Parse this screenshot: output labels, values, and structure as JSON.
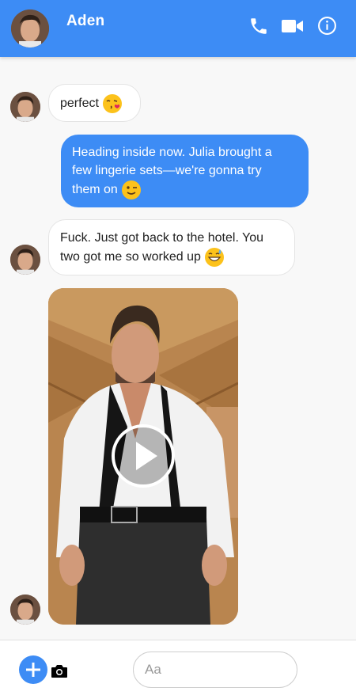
{
  "header": {
    "contact_name": "Aden",
    "call_icon": "phone-icon",
    "video_icon": "video-camera-icon",
    "info_icon": "info-icon",
    "background_color": "#3d8cf5"
  },
  "messages": [
    {
      "direction": "incoming",
      "text": "perfect",
      "emoji": "kissing-heart-emoji"
    },
    {
      "direction": "outgoing",
      "line1": "Heading inside now. Julia brought a",
      "line2": "few lingerie sets—we're gonna try",
      "line3": "them on",
      "emoji": "winking-face-emoji"
    },
    {
      "direction": "incoming",
      "line1": "Fuck. Just got back to the hotel. You",
      "line2": "two got me so worked up",
      "emoji": "grinning-sweat-emoji"
    },
    {
      "direction": "incoming",
      "type": "video",
      "play_icon": "play-icon"
    }
  ],
  "composer": {
    "add_icon": "plus-icon",
    "camera_icon": "camera-icon",
    "placeholder": "Aa",
    "value": ""
  },
  "colors": {
    "accent": "#3d8cf5",
    "incoming_bubble": "#ffffff",
    "page_background": "#f8f8f8"
  }
}
